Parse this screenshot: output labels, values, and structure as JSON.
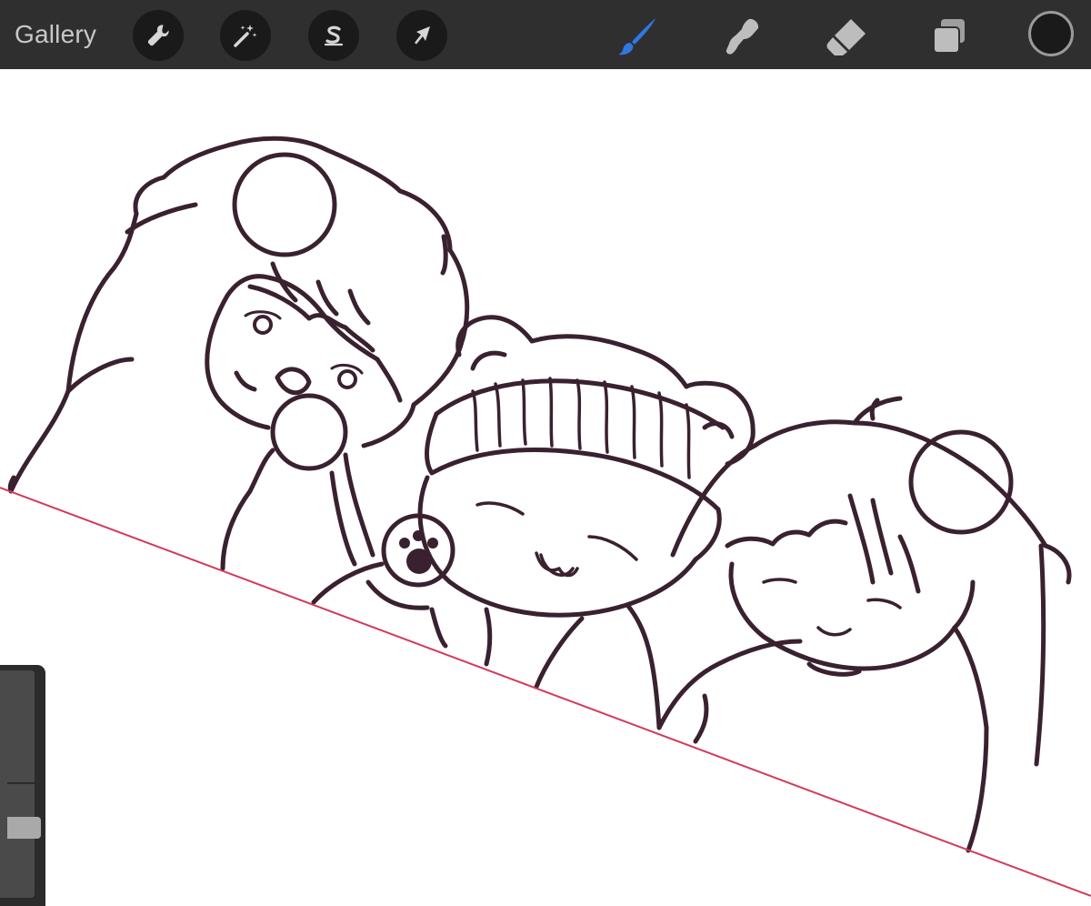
{
  "toolbar": {
    "gallery_label": "Gallery",
    "left_tools": [
      {
        "name": "actions",
        "icon": "wrench-icon"
      },
      {
        "name": "adjustments",
        "icon": "magic-wand-icon"
      },
      {
        "name": "selection",
        "icon": "selection-s-icon"
      },
      {
        "name": "transform",
        "icon": "arrow-cursor-icon"
      }
    ],
    "right_tools": [
      {
        "name": "brush",
        "icon": "paintbrush-icon",
        "active": true,
        "color": "#2f78e4"
      },
      {
        "name": "smudge",
        "icon": "smudge-finger-icon",
        "active": false,
        "color": "#bdbdbd"
      },
      {
        "name": "eraser",
        "icon": "eraser-icon",
        "active": false,
        "color": "#bdbdbd"
      },
      {
        "name": "layers",
        "icon": "layers-icon",
        "active": false,
        "color": "#bdbdbd"
      }
    ],
    "current_color": "#1a1a1a"
  },
  "colors": {
    "toolbar_bg": "#2f2f2f",
    "button_bg": "#1a1a1a",
    "line_art": "#3a2130",
    "guide_line": "#d23a5a"
  },
  "sidebar": {
    "brush_size_level": 0.35,
    "opacity_level": 0.0
  }
}
